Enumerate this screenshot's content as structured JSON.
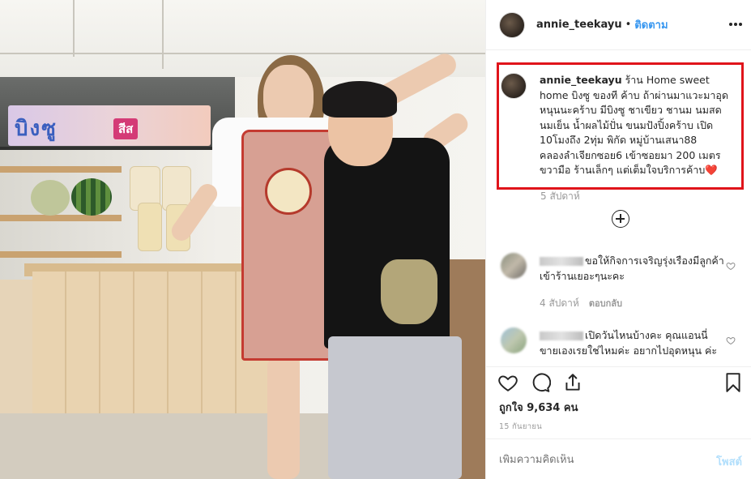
{
  "header": {
    "username": "annie_teekayu",
    "separator": "•",
    "follow_label": "ติดตาม"
  },
  "photo": {
    "sign_text": "บิงซู",
    "sign_badge": "สีส"
  },
  "caption": {
    "username": "annie_teekayu",
    "text": "ร้าน Home sweet home บิงซู ของที ค้าบ ถ้าผ่านมาแวะมาอุดหนุนนะคร้าบ มีบิงซู ชาเขียว ชานม นมสด นมเย็น น้ำผลไม้ปั่น ขนมปังปิ้งคร้าบ เปิด 10โมงถึง 2ทุ่ม พิกัด หมู่บ้านเสนา88 คลองลำเจียกซอย6 เข้าซอยมา 200 เมตร ขวามือ ร้านเล็กๆ แต่เต็มใจบริการค้าบ",
    "emoji": "❤️",
    "time": "5 สัปดาห์"
  },
  "comments": [
    {
      "text": "ขอให้กิจการเจริญรุ่งเรืองมีลูกค้าเข้าร้านเยอะๆนะคะ",
      "time": "4 สัปดาห์",
      "reply_label": "ตอบกลับ"
    },
    {
      "text": "เปิดวันไหนบ้างคะ คุณแอนนี่ขายเองเรยใช่ไหมค่ะ อยากไปอุดหนุน ค่ะ"
    }
  ],
  "stats": {
    "likes": "ถูกใจ 9,634 คน",
    "date": "15 กันยายน"
  },
  "add_comment": {
    "placeholder": "เพิ่มความคิดเห็น",
    "post_label": "โพสต์"
  },
  "colors": {
    "follow": "#3897f0",
    "highlight_box": "#e0141b",
    "post_disabled": "#b2dffc"
  },
  "icons": [
    "more-icon",
    "plus-circle-icon",
    "heart-icon",
    "comment-icon",
    "share-icon",
    "bookmark-icon"
  ]
}
